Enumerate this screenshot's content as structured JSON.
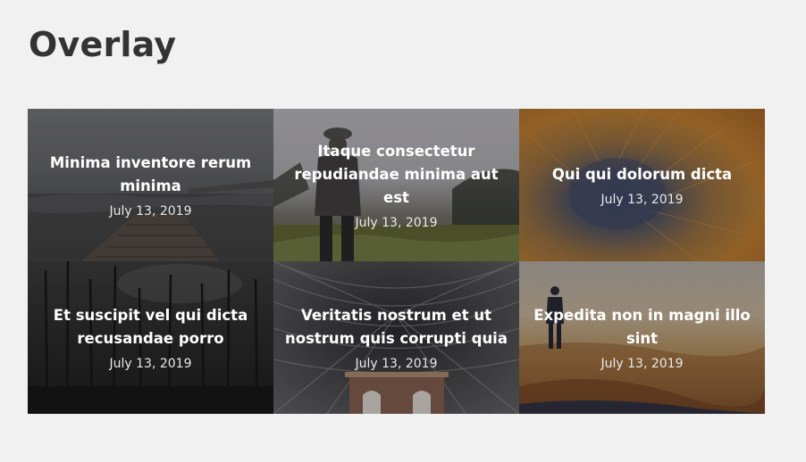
{
  "page": {
    "title": "Overlay"
  },
  "cards": [
    {
      "title": "Minima inventore rerum minima",
      "date": "July 13, 2019",
      "image": "foggy-pier-image"
    },
    {
      "title": "Itaque consectetur repudiandae minima aut est",
      "date": "July 13, 2019",
      "image": "hiker-in-field-image"
    },
    {
      "title": "Qui qui dolorum dicta",
      "date": "July 13, 2019",
      "image": "desert-crater-image"
    },
    {
      "title": "Et suscipit vel qui dicta recusandae porro",
      "date": "July 13, 2019",
      "image": "dark-forest-image"
    },
    {
      "title": "Veritatis nostrum et ut nostrum quis corrupti quia",
      "date": "July 13, 2019",
      "image": "arched-roof-station-image"
    },
    {
      "title": "Expedita non in magni illo sint",
      "date": "July 13, 2019",
      "image": "person-on-beach-image"
    }
  ]
}
